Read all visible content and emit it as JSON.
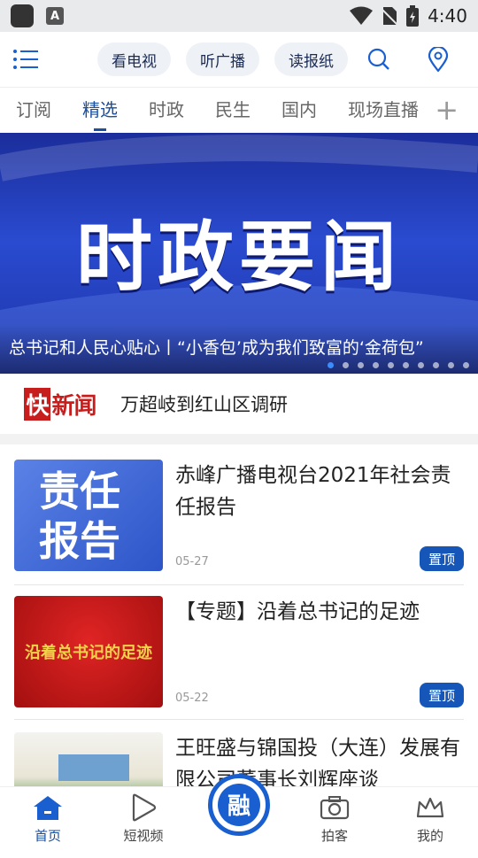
{
  "status_bar": {
    "time": "4:40",
    "a_badge": "A"
  },
  "top_bar": {
    "menu_icon": "menu-icon",
    "pills": [
      "看电视",
      "听广播",
      "读报纸"
    ],
    "search_icon": "search-icon",
    "location_icon": "location-pin-icon"
  },
  "tabs": {
    "items": [
      "订阅",
      "精选",
      "时政",
      "民生",
      "国内",
      "现场直播"
    ],
    "active_index": 1,
    "add_icon": "plus-icon"
  },
  "banner": {
    "title": "时政要闻",
    "caption": "总书记和人民心贴心丨“小香包’成为我们致富的‘金荷包”",
    "dot_count": 10,
    "active_dot": 0
  },
  "flash": {
    "logo_box": "快",
    "logo_rest": "新闻",
    "text": "万超岐到红山区调研"
  },
  "news": [
    {
      "title": "赤峰广播电视台2021年社会责任报告",
      "date": "05-27",
      "pin": "置顶",
      "thumb_text": [
        "责任",
        "报告"
      ]
    },
    {
      "title": "【专题】沿着总书记的足迹",
      "date": "05-22",
      "pin": "置顶",
      "thumb_text": [
        "沿着总书记的足迹"
      ]
    },
    {
      "title": "王旺盛与锦国投（大连）发展有限公司董事长刘辉座谈",
      "date": "",
      "pin": "",
      "thumb_text": []
    }
  ],
  "bottom_nav": {
    "items": [
      {
        "label": "首页",
        "icon": "home-icon"
      },
      {
        "label": "短视频",
        "icon": "play-icon"
      },
      {
        "label": "",
        "icon": "rong-logo-icon",
        "center_text": "融"
      },
      {
        "label": "拍客",
        "icon": "camera-icon"
      },
      {
        "label": "我的",
        "icon": "crown-icon"
      }
    ],
    "active_index": 0
  },
  "colors": {
    "accent": "#1a4fa0",
    "pin": "#1556b8",
    "banner": "#2a4bd0",
    "flash_red": "#c81d1d"
  }
}
